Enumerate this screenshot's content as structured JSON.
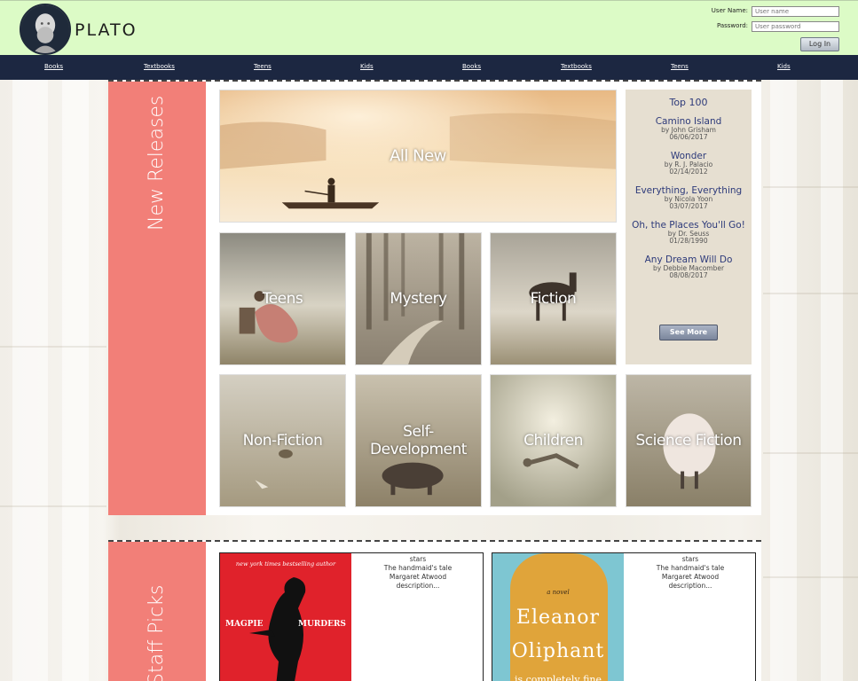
{
  "brand": {
    "name": "PLATO"
  },
  "login": {
    "username_label": "User Name:",
    "username_placeholder": "User name",
    "password_label": "Password:",
    "password_placeholder": "User password",
    "login_button": "Log In"
  },
  "nav": {
    "items": [
      "Books",
      "Textbooks",
      "Teens",
      "Kids",
      "Books",
      "Textbooks",
      "Teens",
      "Kids"
    ]
  },
  "new_releases": {
    "title": "New Releases",
    "tiles": {
      "all_new": "All New",
      "teens": "Teens",
      "mystery": "Mystery",
      "fiction": "Fiction",
      "non_fiction": "Non-Fiction",
      "self_development": "Self-Development",
      "children": "Children",
      "science_fiction": "Science Fiction"
    }
  },
  "top100": {
    "title": "Top 100",
    "books": [
      {
        "title": "Camino Island",
        "author": "by John Grisham",
        "date": "06/06/2017"
      },
      {
        "title": "Wonder",
        "author": "by R. J. Palacio",
        "date": "02/14/2012"
      },
      {
        "title": "Everything, Everything",
        "author": "by Nicola Yoon",
        "date": "03/07/2017"
      },
      {
        "title": "Oh, the Places You'll Go!",
        "author": "by Dr. Seuss",
        "date": "01/28/1990"
      },
      {
        "title": "Any Dream Will Do",
        "author": "by Debbie Macomber",
        "date": "08/08/2017"
      }
    ],
    "see_more": "See More"
  },
  "staff_picks": {
    "title": "Staff Picks",
    "cards": [
      {
        "cover_tagline": "new york times bestselling author",
        "cover_title_left": "MAGPIE",
        "cover_title_right": "MURDERS",
        "stars": "stars",
        "book_title": "The handmaid's tale",
        "author": "Margaret Atwood",
        "description": "description..."
      },
      {
        "cover_tagline": "a novel",
        "cover_title_line1": "Eleanor",
        "cover_title_line2": "Oliphant",
        "cover_title_line3": "is completely fine",
        "stars": "stars",
        "book_title": "The handmaid's tale",
        "author": "Margaret Atwood",
        "description": "description..."
      }
    ]
  },
  "colors": {
    "header_bg": "#dcfbc6",
    "nav_bg": "#1c2741",
    "accent_salmon": "#f27f78",
    "top100_bg": "#e6dfd1",
    "link_blue": "#2d3a7a"
  }
}
